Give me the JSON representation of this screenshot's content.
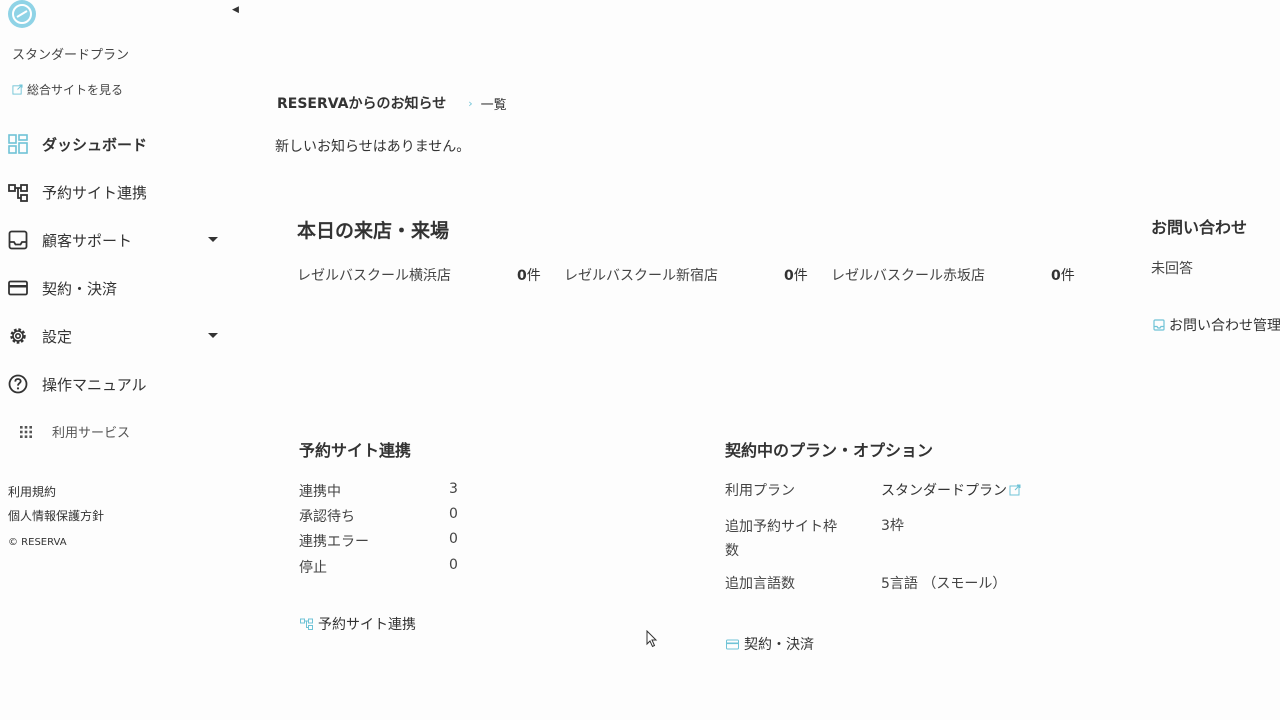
{
  "sidebar": {
    "plan_name": "スタンダードプラン",
    "site_link": "総合サイトを見る",
    "nav": [
      {
        "label": "ダッシュボード",
        "icon": "dashboard-icon",
        "active": true
      },
      {
        "label": "予約サイト連携",
        "icon": "sitemap-icon"
      },
      {
        "label": "顧客サポート",
        "icon": "inbox-icon",
        "dropdown": true
      },
      {
        "label": "契約・決済",
        "icon": "credit-card-icon"
      },
      {
        "label": "設定",
        "icon": "gear-icon",
        "dropdown": true
      },
      {
        "label": "操作マニュアル",
        "icon": "help-icon"
      }
    ],
    "services": "利用サービス",
    "footer_links": [
      "利用規約",
      "個人情報保護方針"
    ],
    "copyright": "© RESERVA"
  },
  "news": {
    "title": "RESERVAからのお知らせ",
    "list_link": "一覧",
    "empty_message": "新しいお知らせはありません。"
  },
  "today": {
    "title": "本日の来店・来場",
    "stores": [
      {
        "name": "レゼルバスクール横浜店",
        "count": "0",
        "unit": "件"
      },
      {
        "name": "レゼルバスクール新宿店",
        "count": "0",
        "unit": "件"
      },
      {
        "name": "レゼルバスクール赤坂店",
        "count": "0",
        "unit": "件"
      }
    ]
  },
  "inquiry": {
    "title": "お問い合わせ",
    "unanswered_label": "未回答",
    "manage_link": "お問い合わせ管理"
  },
  "booking_sites": {
    "title": "予約サイト連携",
    "rows": [
      {
        "label": "連携中",
        "value": "3"
      },
      {
        "label": "承認待ち",
        "value": "0"
      },
      {
        "label": "連携エラー",
        "value": "0"
      },
      {
        "label": "停止",
        "value": "0"
      }
    ],
    "link": "予約サイト連携"
  },
  "contract": {
    "title": "契約中のプラン・オプション",
    "plan_label": "利用プラン",
    "plan_value": "スタンダードプラン",
    "extra_sites_label_1": "追加予約サイト枠",
    "extra_sites_label_2": "数",
    "extra_sites_value": "3枠",
    "languages_label": "追加言語数",
    "languages_value": "5言語 （スモール）",
    "link": "契約・決済"
  },
  "colors": {
    "accent": "#6fc3d6",
    "text": "#333333"
  }
}
